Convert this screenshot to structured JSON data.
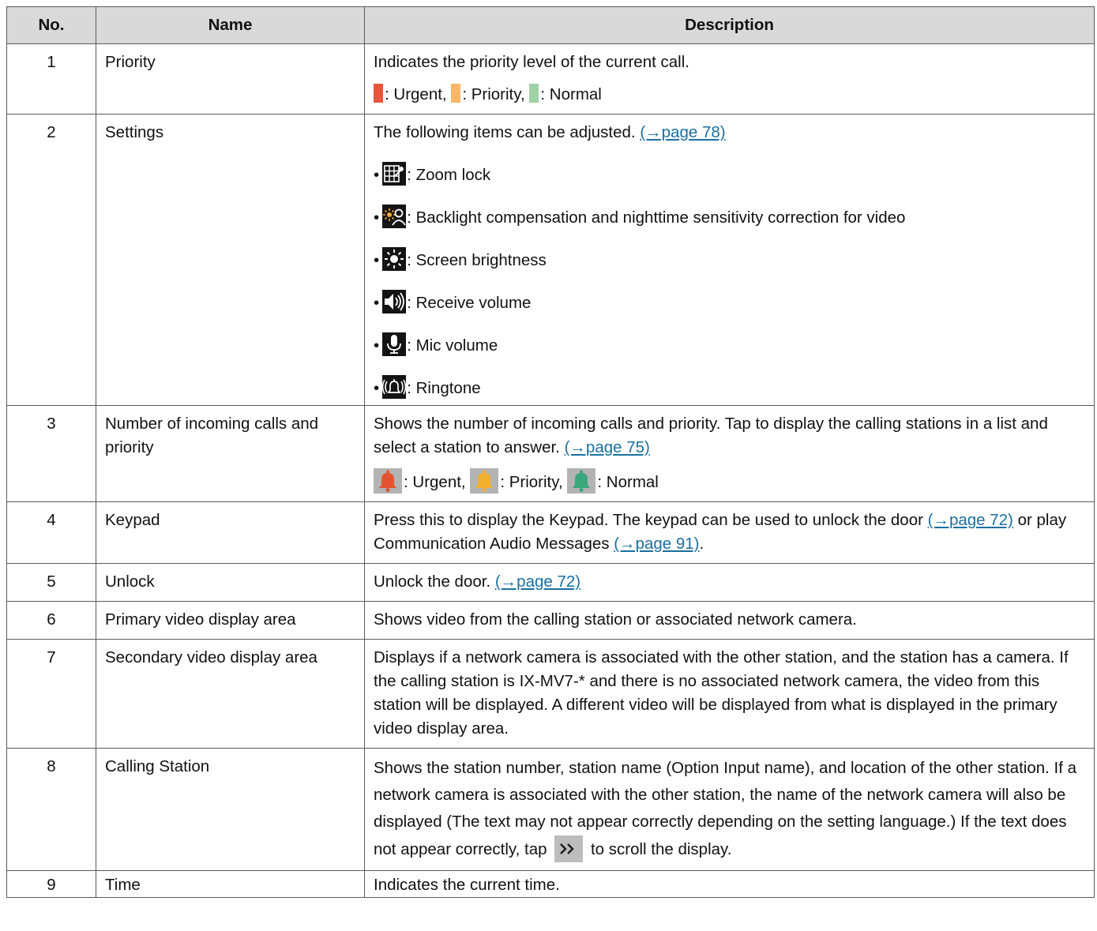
{
  "headers": {
    "no": "No.",
    "name": "Name",
    "description": "Description"
  },
  "rows": {
    "r1": {
      "no": "1",
      "name": "Priority",
      "text": "Indicates the priority level of the current call.",
      "legend": [
        {
          "label": ": Urgent,",
          "color": "#e8553a"
        },
        {
          "label": ": Priority,",
          "color": "#f7b766"
        },
        {
          "label": ": Normal",
          "color": "#9fd3a6"
        }
      ]
    },
    "r2": {
      "no": "2",
      "name": "Settings",
      "text": "The following items can be adjusted.",
      "link": "(→page 78)",
      "bullet": "•",
      "items": [
        {
          "icon": "zoom-lock-icon",
          "label": ": Zoom lock"
        },
        {
          "icon": "backlight-icon",
          "label": ": Backlight compensation and nighttime sensitivity correction for video"
        },
        {
          "icon": "brightness-icon",
          "label": ": Screen brightness"
        },
        {
          "icon": "speaker-icon",
          "label": ": Receive volume"
        },
        {
          "icon": "mic-icon",
          "label": ": Mic volume"
        },
        {
          "icon": "ringtone-icon",
          "label": ": Ringtone"
        }
      ]
    },
    "r3": {
      "no": "3",
      "name": "Number of incoming calls and priority",
      "text": "Shows the number of incoming calls and priority. Tap to display the calling stations in a list and select a station to answer.",
      "link": "(→page 75)",
      "bells": [
        {
          "label": ": Urgent,",
          "color": "#e4532f"
        },
        {
          "label": ": Priority,",
          "color": "#f2b02e"
        },
        {
          "label": ": Normal",
          "color": "#3aa67c"
        }
      ]
    },
    "r4": {
      "no": "4",
      "name": "Keypad",
      "text_a": "Press this to display the Keypad. The keypad can be used to unlock the door",
      "link_a": "(→page 72)",
      "text_b": "or play Communication Audio Messages",
      "link_b": "(→page 91)",
      "text_c": "."
    },
    "r5": {
      "no": "5",
      "name": "Unlock",
      "text": "Unlock the door.",
      "link": "(→page 72)"
    },
    "r6": {
      "no": "6",
      "name": "Primary video display area",
      "text": "Shows video from the calling station or associated network camera."
    },
    "r7": {
      "no": "7",
      "name": "Secondary video display area",
      "text": "Displays if a network camera is associated with the other station, and the station has a camera. If the calling station is IX-MV7-* and there is no associated network camera, the video from this station will be displayed. A different video will be displayed from what is displayed in the primary video display area."
    },
    "r8": {
      "no": "8",
      "name": "Calling Station",
      "text_a": "Shows the station number, station name (Option Input name), and location of the other station. If a network camera is associated with the other station, the name of the network camera will also be displayed (The text may not appear correctly depending on the setting language.) If the text does not appear correctly, tap",
      "text_b": "to scroll the display."
    },
    "r9": {
      "no": "9",
      "name": "Time",
      "text": "Indicates the current time."
    }
  }
}
